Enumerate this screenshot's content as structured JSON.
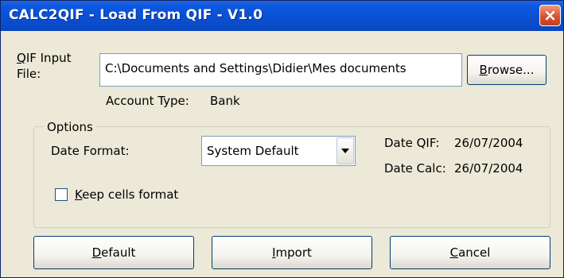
{
  "window": {
    "title": "CALC2QIF - Load From QIF - V1.0",
    "close_glyph": "×"
  },
  "qif_input": {
    "label_accel": "Q",
    "label_rest": "IF Input File:",
    "value": "C:\\Documents and Settings\\Didier\\Mes documents",
    "browse_accel": "B",
    "browse_rest": "rowse..."
  },
  "account_type": {
    "label": "Account Type:",
    "value": "Bank"
  },
  "options": {
    "legend": "Options",
    "date_format_label": "Date Format:",
    "date_format_value": "System Default",
    "date_qif_label": "Date QIF:",
    "date_qif_value": "26/07/2004",
    "date_calc_label": "Date Calc:",
    "date_calc_value": "26/07/2004",
    "keep_cells": {
      "accel": "K",
      "rest": "eep cells format",
      "checked": false
    }
  },
  "buttons": {
    "default": {
      "accel": "D",
      "rest": "efault"
    },
    "import": {
      "accel": "I",
      "rest": "mport"
    },
    "cancel": {
      "accel": "C",
      "rest": "ancel"
    }
  }
}
